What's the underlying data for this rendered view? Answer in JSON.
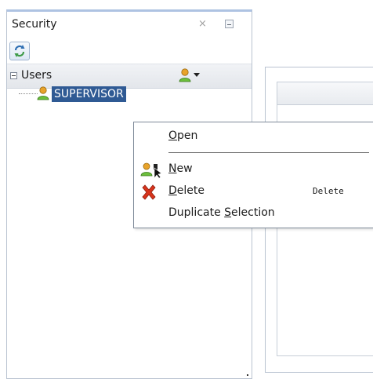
{
  "panel": {
    "title": "Security",
    "close_glyph": "×",
    "minimize_icon": "minimize-icon",
    "refresh_icon": "refresh-icon"
  },
  "users_section": {
    "label": "Users",
    "collapse_icon": "collapse-minus-icon",
    "add_user_icon": "user-icon"
  },
  "tree": {
    "nodes": [
      {
        "label": "SUPERVISOR",
        "icon": "user-icon",
        "selected": true
      }
    ]
  },
  "context_menu": {
    "items": [
      {
        "label": "Open",
        "mnemonic": "O",
        "rest": "pen",
        "shortcut": "",
        "icon": ""
      },
      {
        "label": "New",
        "mnemonic": "N",
        "rest": "ew",
        "shortcut": "",
        "icon": "new-user-icon"
      },
      {
        "label": "Delete",
        "mnemonic": "D",
        "rest": "elete",
        "shortcut": "Delete",
        "icon": "delete-x-icon"
      },
      {
        "label": "Duplicate Selection",
        "prefix": "Duplicate ",
        "mnemonic": "S",
        "rest": "election",
        "shortcut": "",
        "icon": ""
      }
    ]
  },
  "colors": {
    "selection_bg": "#2f5a94",
    "panel_border": "#b9c3d1",
    "panel_top_accent": "#aec3e2",
    "delete_red": "#d8341c",
    "user_green": "#6cbf3b",
    "user_orange": "#e8a32a"
  }
}
